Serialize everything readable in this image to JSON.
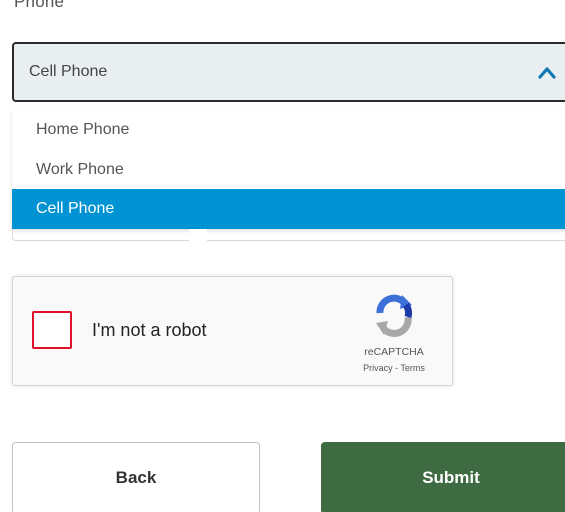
{
  "phone": {
    "label": "Phone",
    "selected_value": "Cell Phone",
    "options": [
      {
        "label": "Home Phone",
        "selected": false
      },
      {
        "label": "Work Phone",
        "selected": false
      },
      {
        "label": "Cell Phone",
        "selected": true
      }
    ]
  },
  "captcha": {
    "label": "I'm not a robot",
    "brand": "reCAPTCHA",
    "links": "Privacy - Terms"
  },
  "actions": {
    "back_label": "Back",
    "submit_label": "Submit"
  },
  "colors": {
    "selected_option_bg": "#0093d4",
    "submit_bg": "#3e6b41",
    "checkbox_border": "#e0112b",
    "chevron": "#0f78b4"
  },
  "icons": {
    "chevron": "chevron-up-icon",
    "captcha_logo": "recaptcha-logo-icon"
  }
}
